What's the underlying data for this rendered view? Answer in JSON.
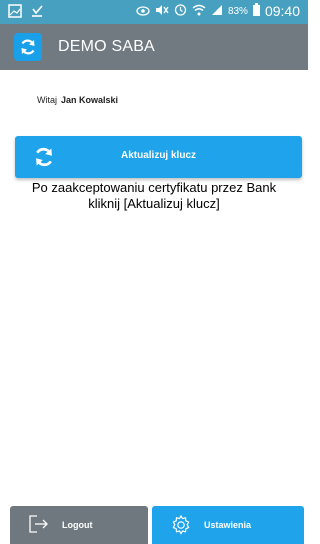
{
  "status_bar": {
    "battery_percent": "83%",
    "time": "09:40",
    "icons": [
      "gallery-icon",
      "download-icon",
      "eye-icon",
      "mute-icon",
      "alarm-icon",
      "wifi-icon",
      "signal-icon",
      "battery-icon"
    ]
  },
  "app_bar": {
    "title": "DEMO SABA",
    "icon": "refresh-icon"
  },
  "welcome": {
    "greeting": "Witaj",
    "user_name": "Jan Kowalski"
  },
  "update_button": {
    "label": "Aktualizuj klucz",
    "icon": "refresh-icon"
  },
  "message": {
    "text": "Po zaakceptowaniu certyfikatu przez Bank kliknij [Aktualizuj klucz]"
  },
  "footer": {
    "logout_label": "Logout",
    "logout_icon": "logout-icon",
    "settings_label": "Ustawienia",
    "settings_icon": "gear-icon"
  },
  "colors": {
    "status_bar": "#47a0bf",
    "app_bar": "#707a80",
    "accent": "#1fa3ea",
    "logout_button": "#6e787e"
  }
}
